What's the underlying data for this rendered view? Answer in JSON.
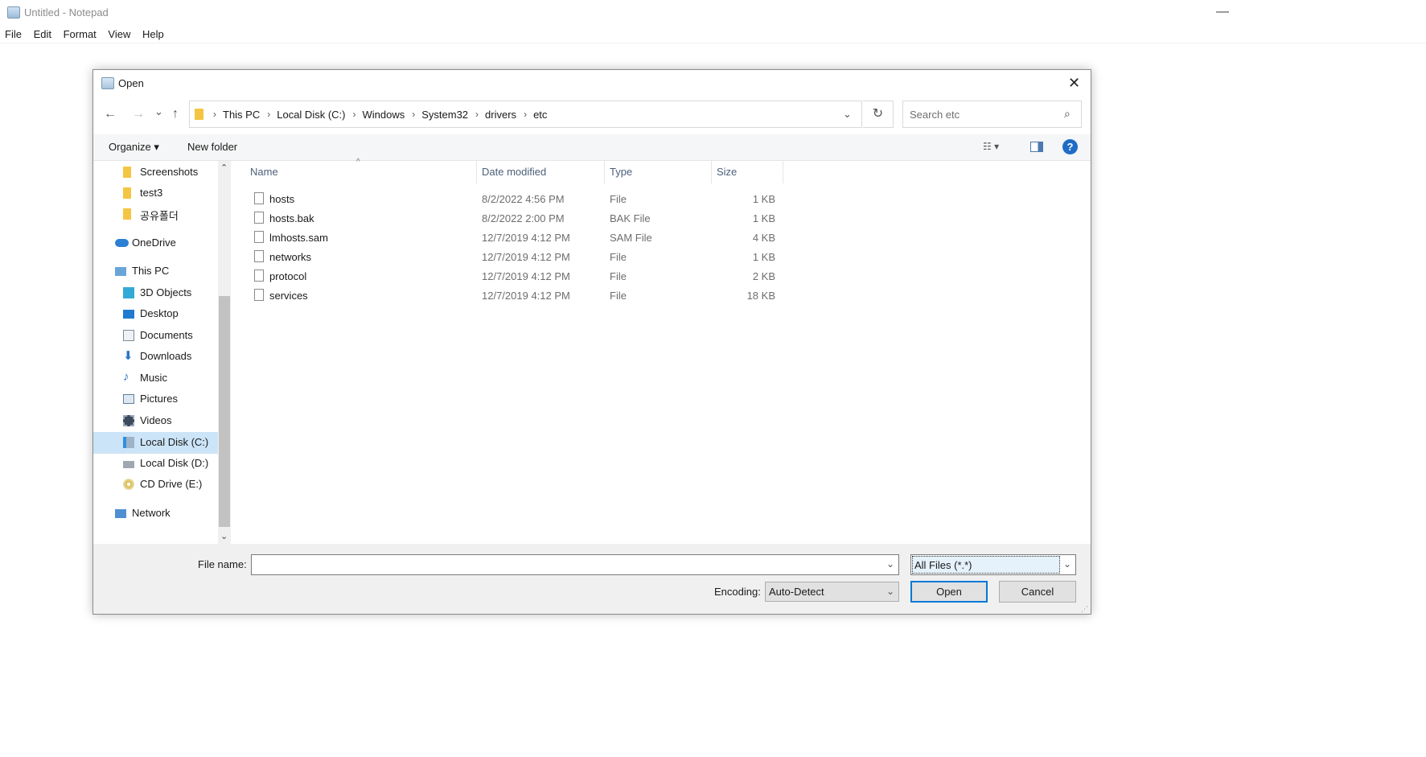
{
  "notepad": {
    "title": "Untitled - Notepad",
    "minimize_glyph": "—",
    "menu": [
      "File",
      "Edit",
      "Format",
      "View",
      "Help"
    ]
  },
  "dialog": {
    "title": "Open",
    "close_glyph": "✕",
    "nav": {
      "back": "←",
      "forward": "→",
      "recent": "⌄",
      "up": "↑"
    },
    "address": {
      "crumbs": [
        "This PC",
        "Local Disk (C:)",
        "Windows",
        "System32",
        "drivers",
        "etc"
      ],
      "separator": "›",
      "dropdown": "⌄"
    },
    "refresh_glyph": "↻",
    "search": {
      "placeholder": "Search etc",
      "icon": "⌕"
    },
    "toolbar": {
      "organize": "Organize ▾",
      "new_folder": "New folder",
      "view_glyph": "☷ ▾",
      "help_glyph": "?"
    },
    "nav_pane": {
      "items": [
        {
          "label": "Screenshots",
          "icon": "folder-icon"
        },
        {
          "label": "test3",
          "icon": "folder-icon"
        },
        {
          "label": "공유폴더",
          "icon": "folder-icon"
        },
        {
          "label": "OneDrive",
          "icon": "cloud-icon"
        },
        {
          "label": "This PC",
          "icon": "pc-icon"
        },
        {
          "label": "3D Objects",
          "icon": "cube-icon"
        },
        {
          "label": "Desktop",
          "icon": "desktop-icon"
        },
        {
          "label": "Documents",
          "icon": "document-icon"
        },
        {
          "label": "Downloads",
          "icon": "download-icon"
        },
        {
          "label": "Music",
          "icon": "music-icon"
        },
        {
          "label": "Pictures",
          "icon": "picture-icon"
        },
        {
          "label": "Videos",
          "icon": "video-icon"
        },
        {
          "label": "Local Disk (C:)",
          "icon": "drive-icon",
          "selected": true
        },
        {
          "label": "Local Disk (D:)",
          "icon": "drive-icon"
        },
        {
          "label": "CD Drive (E:)",
          "icon": "cd-icon"
        },
        {
          "label": "Network",
          "icon": "network-icon"
        }
      ],
      "scroll_up": "⌃",
      "scroll_down": "⌄"
    },
    "columns": {
      "name": "Name",
      "date": "Date modified",
      "type": "Type",
      "size": "Size",
      "sort_caret": "^"
    },
    "files": [
      {
        "name": "hosts",
        "date": "8/2/2022 4:56 PM",
        "type": "File",
        "size": "1 KB"
      },
      {
        "name": "hosts.bak",
        "date": "8/2/2022 2:00 PM",
        "type": "BAK File",
        "size": "1 KB"
      },
      {
        "name": "lmhosts.sam",
        "date": "12/7/2019 4:12 PM",
        "type": "SAM File",
        "size": "4 KB"
      },
      {
        "name": "networks",
        "date": "12/7/2019 4:12 PM",
        "type": "File",
        "size": "1 KB"
      },
      {
        "name": "protocol",
        "date": "12/7/2019 4:12 PM",
        "type": "File",
        "size": "2 KB"
      },
      {
        "name": "services",
        "date": "12/7/2019 4:12 PM",
        "type": "File",
        "size": "18 KB"
      }
    ],
    "bottom": {
      "filename_label": "File name:",
      "filename_value": "",
      "filetype_value": "All Files  (*.*)",
      "encoding_label": "Encoding:",
      "encoding_value": "Auto-Detect",
      "open_label": "Open",
      "cancel_label": "Cancel",
      "dropdown": "⌄",
      "grip": "⋰"
    }
  },
  "colors": {
    "folder": "#f4c542",
    "accent": "#0078d7",
    "selection": "#cce4f7",
    "help": "#1f6cc6"
  }
}
